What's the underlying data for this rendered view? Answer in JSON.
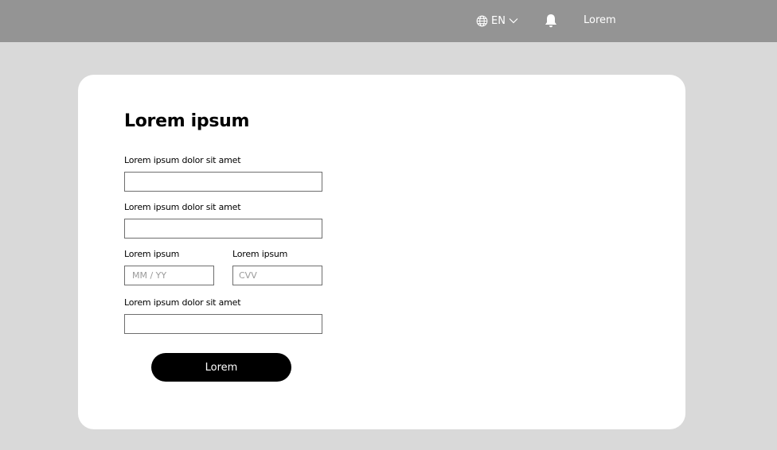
{
  "header": {
    "language": "EN",
    "user_label": "Lorem"
  },
  "form": {
    "title": "Lorem ipsum",
    "field1_label": "Lorem ipsum dolor sit amet",
    "field1_value": "",
    "field2_label": "Lorem ipsum dolor sit amet",
    "field2_value": "",
    "expiry_label": "Lorem ipsum",
    "expiry_placeholder": "MM / YY",
    "cvv_label": "Lorem ipsum",
    "cvv_placeholder": "CVV",
    "field4_label": "Lorem ipsum dolor sit amet",
    "field4_value": "",
    "submit_label": "Lorem"
  },
  "colors": {
    "topbar": "#949494",
    "background": "#d9d9d9",
    "button": "#000000"
  },
  "icons": [
    "globe-icon",
    "chevron-down-icon",
    "bell-icon"
  ]
}
